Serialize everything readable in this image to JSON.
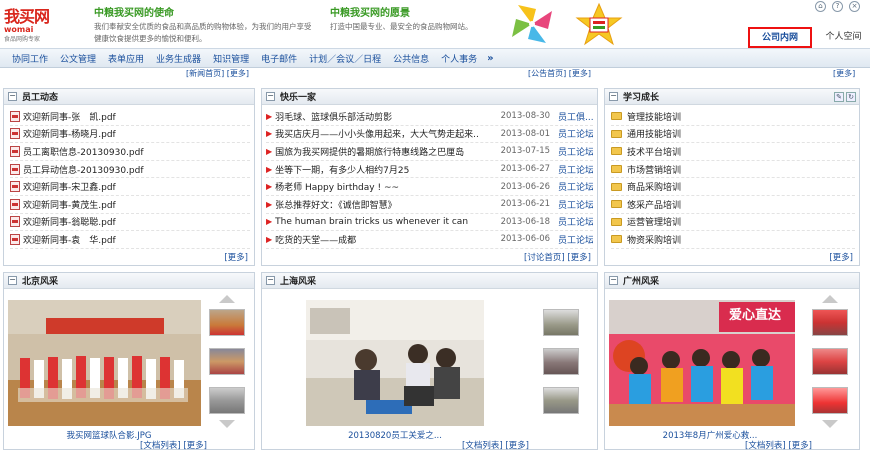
{
  "logo": {
    "cn": "我买网",
    "en": "womai",
    "sub": "食品网购专家"
  },
  "mission": {
    "title": "中粮我买网的使命",
    "desc1": "我们奉献安全优质的食品和高品质的购物体验，为我们的用户享受",
    "desc2": "健康饮食提供更多的愉悦和便利。"
  },
  "vision": {
    "title": "中粮我买网的愿景",
    "desc1": "打造中国最专业、最安全的食品购物网站。"
  },
  "tabs": {
    "company": "公司内网",
    "personal": "个人空间"
  },
  "nav": [
    "协同工作",
    "公文管理",
    "表单应用",
    "业务生成器",
    "知识管理",
    "电子邮件",
    "计划／会议／日程",
    "公共信息",
    "个人事务",
    "»"
  ],
  "prev_row": {
    "left": "[新闻首页] [更多]",
    "middle": "[公告首页] [更多]",
    "right": "[更多]"
  },
  "staff_news": {
    "title": "员工动态",
    "items": [
      "欢迎新同事-张　凯.pdf",
      "欢迎新同事-杨晓月.pdf",
      "员工离职信息-20130930.pdf",
      "员工异动信息-20130930.pdf",
      "欢迎新同事-宋卫鑫.pdf",
      "欢迎新同事-黄茂生.pdf",
      "欢迎新同事-翁聪聪.pdf",
      "欢迎新同事-袁　华.pdf"
    ],
    "more": "[更多]"
  },
  "happy_family": {
    "title": "快乐一家",
    "items": [
      {
        "text": "羽毛球、篮球俱乐部活动剪影",
        "date": "2013-08-30",
        "tag": "员工俱..."
      },
      {
        "text": "我买店庆月——小小头像用起来，大大气势走起来..",
        "date": "2013-08-01",
        "tag": "员工论坛"
      },
      {
        "text": "国旅为我买网提供的暑期旅行特惠线路之巴厘岛",
        "date": "2013-07-15",
        "tag": "员工论坛"
      },
      {
        "text": "坐等下一期，有多少人相约7月25",
        "date": "2013-06-27",
        "tag": "员工论坛"
      },
      {
        "text": "杨老师 Happy birthday ! ~~",
        "date": "2013-06-26",
        "tag": "员工论坛"
      },
      {
        "text": "张总推荐好文：《诚信即智慧》",
        "date": "2013-06-21",
        "tag": "员工论坛"
      },
      {
        "text": "The human brain tricks us whenever it can",
        "date": "2013-06-18",
        "tag": "员工论坛"
      },
      {
        "text": "吃货的天堂——成都",
        "date": "2013-06-06",
        "tag": "员工论坛"
      }
    ],
    "more": "[讨论首页] [更多]"
  },
  "learning": {
    "title": "学习成长",
    "items": [
      "管理技能培训",
      "通用技能培训",
      "技术平台培训",
      "市场营销培训",
      "商品采购培训",
      "悠采产品培训",
      "运营管理培训",
      "物资采购培训"
    ],
    "more": "[更多]"
  },
  "beijing": {
    "title": "北京风采",
    "caption": "我买网篮球队合影.JPG",
    "links": "[文档列表] [更多]"
  },
  "shanghai": {
    "title": "上海风采",
    "caption": "20130820员工关爱之...",
    "links": "[文档列表] [更多]"
  },
  "guangzhou": {
    "title": "广州风采",
    "caption": "2013年8月广州爱心救...",
    "links": "[文档列表] [更多]",
    "banner": "爱心直达"
  }
}
